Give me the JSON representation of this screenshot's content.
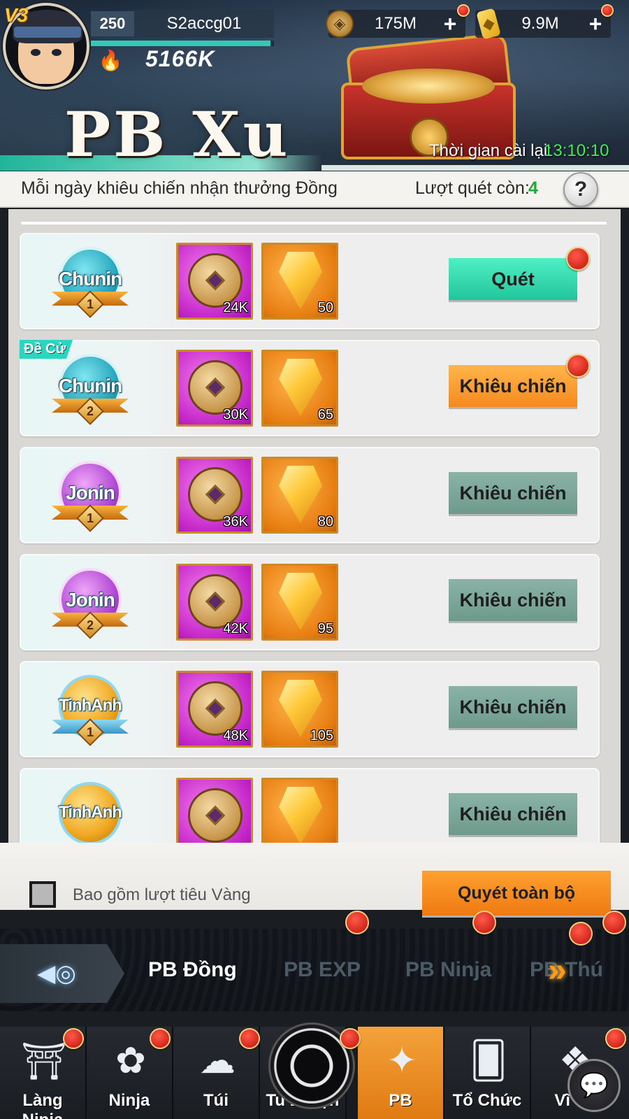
{
  "player": {
    "vip": "V3",
    "level": "250",
    "name": "S2accg01",
    "power": "5166K",
    "exp_fraction": 0.98
  },
  "currencies": {
    "coins": "175M",
    "gold": "9.9M",
    "plus": "+"
  },
  "header": {
    "title": "PB Xu",
    "reset_label": "Thời gian cài lại:",
    "reset_time": "13:10:10"
  },
  "info": {
    "text": "Mỗi ngày khiêu chiến nhận thưởng Đồng",
    "turns_label": "Lượt quét còn:",
    "turns_value": "4",
    "help": "?"
  },
  "rows": [
    {
      "badge": "Chunin",
      "tier": "1",
      "coin": "24K",
      "gem": "50",
      "action": "Quét",
      "recommend": ""
    },
    {
      "badge": "Chunin",
      "tier": "2",
      "coin": "30K",
      "gem": "65",
      "action": "Khiêu chiến",
      "recommend": "Đề Cử"
    },
    {
      "badge": "Jonin",
      "tier": "1",
      "coin": "36K",
      "gem": "80",
      "action": "Khiêu chiến",
      "recommend": ""
    },
    {
      "badge": "Jonin",
      "tier": "2",
      "coin": "42K",
      "gem": "95",
      "action": "Khiêu chiến",
      "recommend": ""
    },
    {
      "badge": "TinhAnh",
      "tier": "1",
      "coin": "48K",
      "gem": "105",
      "action": "Khiêu chiến",
      "recommend": ""
    },
    {
      "badge": "TinhAnh",
      "tier": "",
      "coin": "",
      "gem": "",
      "action": "Khiêu chiến",
      "recommend": ""
    }
  ],
  "bottom": {
    "checkbox_label": "Bao gồm lượt tiêu Vàng",
    "sweep_all": "Quyét toàn bộ"
  },
  "tabs": [
    "PB Đồng",
    "PB EXP",
    "PB Ninja",
    "PB Thú"
  ],
  "nav": [
    "Làng Ninja",
    "Ninja",
    "Túi",
    "Tu Luyện",
    "PB",
    "Tổ Chức",
    "Vĩ Thú"
  ],
  "colors": {
    "accent_orange": "#f58a1e",
    "accent_green": "#22c49b",
    "time_green": "#3cf05a",
    "notify_red": "#c0100a"
  }
}
